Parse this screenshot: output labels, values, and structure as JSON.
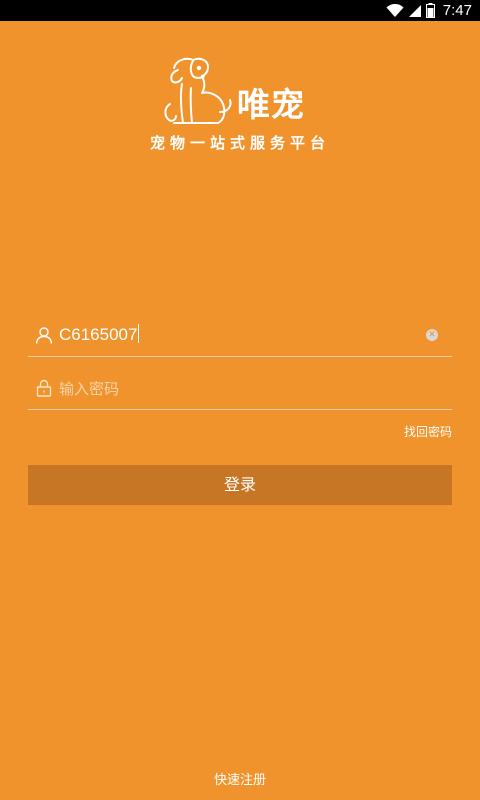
{
  "status_bar": {
    "time": "7:47",
    "icons": [
      "wifi-icon",
      "signal-icon",
      "battery-icon"
    ]
  },
  "logo": {
    "icon": "dog-logo-icon",
    "name": "唯宠",
    "slogan": "宠物一站式服务平台"
  },
  "form": {
    "username": {
      "icon": "user-icon",
      "value": "C6165007",
      "clear_icon": "clear-icon"
    },
    "password": {
      "icon": "lock-icon",
      "placeholder": "输入密码"
    },
    "forgot_password": "找回密码",
    "login_button": "登录"
  },
  "footer": {
    "register_link": "快速注册"
  },
  "colors": {
    "background": "#F0932D",
    "button": "#C67625",
    "text": "#FFFFFF"
  }
}
